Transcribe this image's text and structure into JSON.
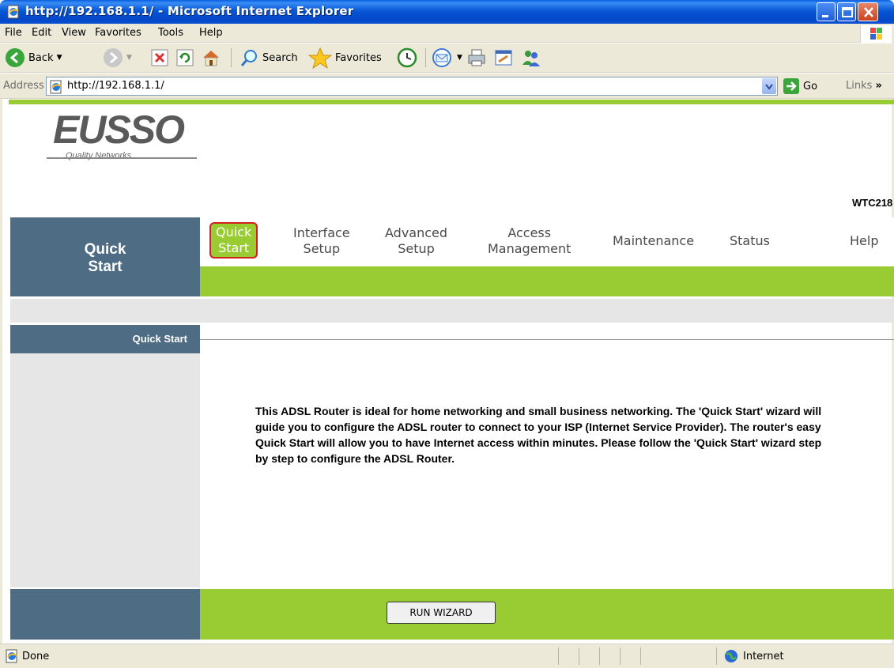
{
  "window": {
    "title": "http://192.168.1.1/ - Microsoft Internet Explorer"
  },
  "menu": [
    "File",
    "Edit",
    "View",
    "Favorites",
    "Tools",
    "Help"
  ],
  "toolbar": {
    "back_label": "Back",
    "search_label": "Search",
    "favorites_label": "Favorites"
  },
  "address": {
    "label": "Address",
    "url": "http://192.168.1.1/",
    "go_label": "Go",
    "links_label": "Links"
  },
  "router": {
    "brand": "EUSSO",
    "tagline": "Quality Networks",
    "model": "WTC218",
    "section_title": "Quick Start",
    "current_page": "Quick Start",
    "nav": [
      {
        "label_line1": "Quick",
        "label_line2": "Start"
      },
      {
        "label_line1": "Interface",
        "label_line2": "Setup"
      },
      {
        "label_line1": "Advanced",
        "label_line2": "Setup"
      },
      {
        "label_line1": "Access",
        "label_line2": "Management"
      },
      {
        "label_line1": "Maintenance",
        "label_line2": ""
      },
      {
        "label_line1": "Status",
        "label_line2": ""
      },
      {
        "label_line1": "Help",
        "label_line2": ""
      }
    ],
    "intro_text": "This ADSL Router is ideal for home networking and small business networking. The 'Quick Start' wizard will guide you to configure the ADSL router to connect to your ISP (Internet Service Provider). The router's easy Quick Start will allow you to have Internet access within minutes. Please follow the 'Quick Start' wizard step by step to configure the ADSL Router.",
    "run_wizard_label": "RUN WIZARD",
    "colors": {
      "accent_green": "#99cc33",
      "nav_blue": "#4e6c84",
      "highlight_red": "#d02020"
    }
  },
  "statusbar": {
    "status": "Done",
    "zone": "Internet"
  }
}
